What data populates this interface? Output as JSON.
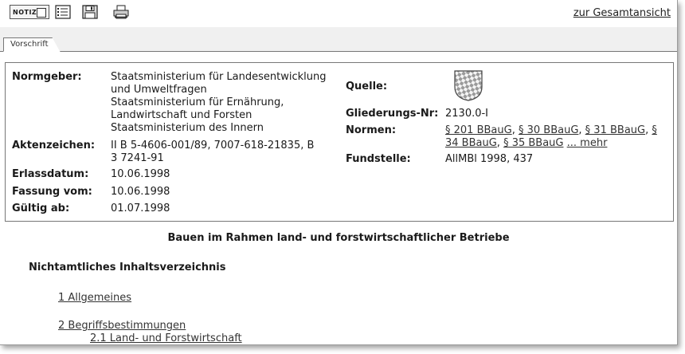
{
  "toolbar": {
    "notiz_label": "NOTIZ",
    "icons": [
      "list-icon",
      "save-disk-icon",
      "printer-icon"
    ],
    "gesamtansicht_link": "zur Gesamtansicht"
  },
  "tab": {
    "label": "Vorschrift"
  },
  "meta": {
    "normgeber_label": "Normgeber:",
    "normgeber_lines": [
      "Staatsministerium für Landesentwicklung",
      "und Umweltfragen",
      "Staatsministerium für Ernährung,",
      "Landwirtschaft und Forsten",
      "Staatsministerium des Innern"
    ],
    "aktenzeichen_label": "Aktenzeichen:",
    "aktenzeichen_lines": [
      "II B 5-4606-001/89, 7007-618-21835, B",
      "3 7241-91"
    ],
    "erlassdatum_label": "Erlassdatum:",
    "erlassdatum": "10.06.1998",
    "fassung_label": "Fassung vom:",
    "fassung": "10.06.1998",
    "gueltig_label": "Gültig ab:",
    "gueltig": "01.07.1998",
    "quelle_label": "Quelle:",
    "gliederung_label": "Gliederungs-Nr:",
    "gliederung": "2130.0-I",
    "normen_label": "Normen:",
    "normen_links": [
      "§ 201 BBauG",
      "§ 30 BBauG",
      "§ 31 BBauG",
      "§ 34 BBauG",
      "§ 35 BBauG"
    ],
    "normen_more": "... mehr",
    "fundstelle_label": "Fundstelle:",
    "fundstelle": "AllMBl 1998, 437"
  },
  "document": {
    "title": "Bauen im Rahmen land- und forstwirtschaftlicher Betriebe",
    "toc_heading": "Nichtamtliches Inhaltsverzeichnis",
    "toc": [
      "1 Allgemeines",
      "2 Begriffsbestimmungen",
      "2.1 Land- und Forstwirtschaft"
    ]
  }
}
